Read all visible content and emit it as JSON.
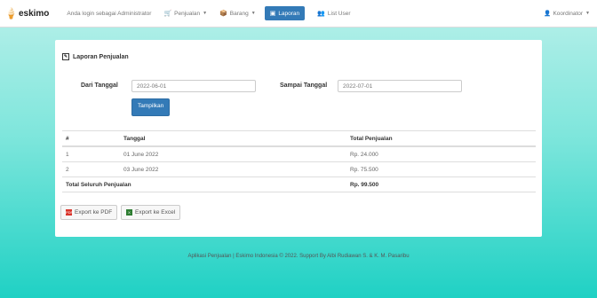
{
  "navbar": {
    "brand": "eskimo",
    "login_text": "Anda login sebagai Administrator",
    "menu": [
      {
        "label": "Penjualan",
        "icon": "cart-icon"
      },
      {
        "label": "Barang",
        "icon": "box-icon"
      },
      {
        "label": "Laporan",
        "icon": "report-icon"
      },
      {
        "label": "List User",
        "icon": "users-icon"
      }
    ],
    "user": "Koordinator"
  },
  "panel": {
    "title": "Laporan Penjualan",
    "from_label": "Dari Tanggal",
    "from_value": "2022-06-01",
    "to_label": "Sampai Tanggal",
    "to_value": "2022-07-01",
    "show_button": "Tampilkan"
  },
  "table": {
    "headers": [
      "#",
      "Tanggal",
      "Total Penjualan"
    ],
    "rows": [
      [
        "1",
        "01 June 2022",
        "Rp. 24.000"
      ],
      [
        "2",
        "03 June 2022",
        "Rp. 75.500"
      ]
    ],
    "total_label": "Total Seluruh Penjualan",
    "total_value": "Rp. 99.500"
  },
  "export": {
    "pdf": "Export ke PDF",
    "excel": "Export ke Excel"
  },
  "footer": "Aplikasi Penjualan | Eskimo Indonesia © 2022. Support By Albi Rudiawan S. & K. M. Pasaribu"
}
